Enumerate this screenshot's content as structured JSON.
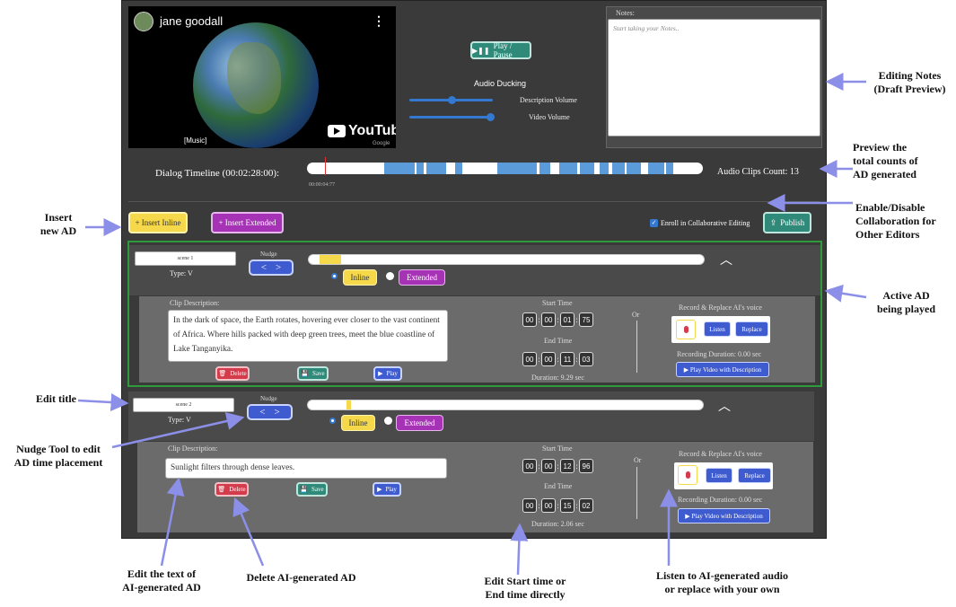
{
  "video": {
    "channel_name": "jane goodall",
    "caption": "[Music]",
    "brand": "YouTube",
    "brand_sub": "Google"
  },
  "controls": {
    "play_pause_label": "Play / Pause",
    "audio_ducking_label": "Audio Ducking",
    "description_volume_label": "Description Volume",
    "video_volume_label": "Video Volume",
    "description_volume_level": 0.5,
    "video_volume_level": 1.0
  },
  "notes": {
    "label": "Notes:",
    "placeholder": "Start taking your Notes.."
  },
  "timeline": {
    "label": "Dialog Timeline (00:02:28:00):",
    "current_time": "00:00:04:77",
    "clips_count_label": "Audio Clips Count: 13"
  },
  "toolbar": {
    "insert_inline": "+ Insert Inline",
    "insert_extended": "+ Insert Extended",
    "enroll_label": "Enroll in Collaborative Editing",
    "publish": "Publish"
  },
  "scenes": [
    {
      "title": "scene 1",
      "type": "Type: V",
      "nudge_label": "Nudge",
      "inline_label": "Inline",
      "extended_label": "Extended",
      "clip_description_label": "Clip Description:",
      "description": "In the dark of space, the Earth rotates, hovering ever closer to the vast continent of Africa. Where hills packed with deep green trees, meet the blue coastline of Lake Tanganyika.",
      "delete": "Delete",
      "save": "Save",
      "play": "Play",
      "start_time_label": "Start Time",
      "start": [
        "00",
        "00",
        "01",
        "75"
      ],
      "end_time_label": "End Time",
      "end": [
        "00",
        "00",
        "11",
        "03"
      ],
      "duration": "Duration: 9.29 sec",
      "or": "Or",
      "record_label": "Record & Replace AI's voice",
      "listen": "Listen",
      "replace": "Replace",
      "recording_duration": "Recording Duration: 0.00 sec",
      "play_with_desc": "Play Video with Description"
    },
    {
      "title": "scene 2",
      "type": "Type: V",
      "nudge_label": "Nudge",
      "inline_label": "Inline",
      "extended_label": "Extended",
      "clip_description_label": "Clip Description:",
      "description": "Sunlight filters through dense leaves.",
      "delete": "Delete",
      "save": "Save",
      "play": "Play",
      "start_time_label": "Start Time",
      "start": [
        "00",
        "00",
        "12",
        "96"
      ],
      "end_time_label": "End Time",
      "end": [
        "00",
        "00",
        "15",
        "02"
      ],
      "duration": "Duration: 2.06 sec",
      "or": "Or",
      "record_label": "Record & Replace AI's voice",
      "listen": "Listen",
      "replace": "Replace",
      "recording_duration": "Recording Duration: 0.00 sec",
      "play_with_desc": "Play Video with Description"
    }
  ],
  "annotations": {
    "editing_notes": "Editing Notes\n(Draft Preview)",
    "preview_counts": "Preview the\ntotal counts of\nAD generated",
    "enable_collab": "Enable/Disable\nCollaboration for\nOther Editors",
    "insert_ad": "Insert\nnew AD",
    "active_ad": "Active AD\nbeing played",
    "edit_title": "Edit title",
    "nudge_tool": "Nudge Tool to edit\nAD time placement",
    "edit_text": "Edit the text of\nAI-generated AD",
    "delete_ad": "Delete AI-generated AD",
    "edit_time": "Edit Start time or\nEnd time directly",
    "listen_replace": "Listen to AI-generated audio\nor replace with your own"
  }
}
